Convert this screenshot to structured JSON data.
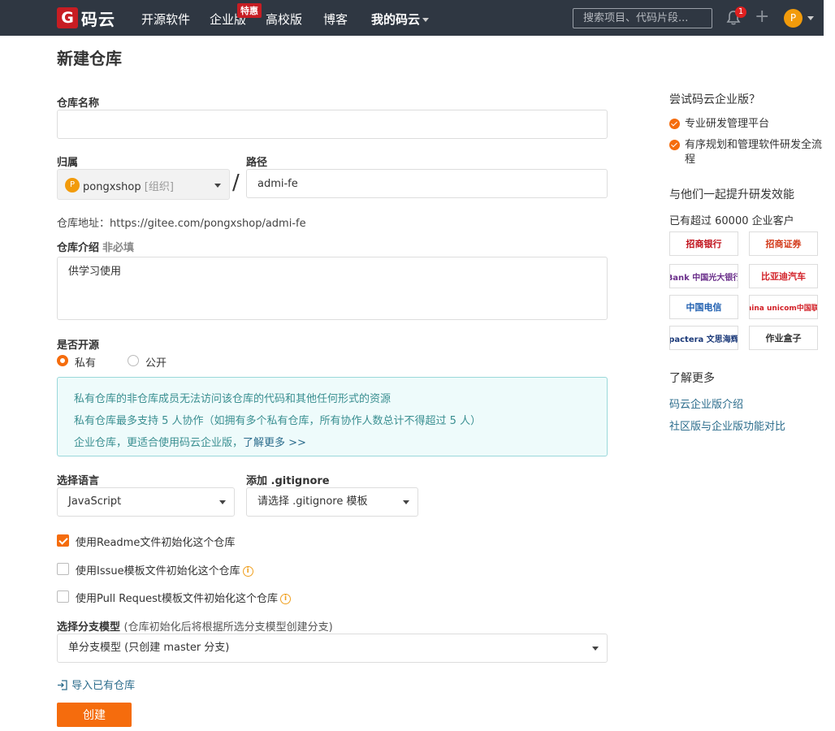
{
  "navbar": {
    "logo_mark": "G",
    "logo_text": "码云",
    "links": [
      "开源软件",
      "企业版",
      "高校版",
      "博客",
      "我的码云"
    ],
    "promo_badge": "特惠",
    "search_placeholder": "搜索项目、代码片段...",
    "notification_count": "1",
    "plus": "+",
    "avatar_letter": "P"
  },
  "page": {
    "title": "新建仓库"
  },
  "form": {
    "repo_name_label": "仓库名称",
    "repo_name_value": "",
    "owner_label": "归属",
    "owner_avatar": "P",
    "owner_name": "pongxshop",
    "owner_type": "[组织]",
    "path_label": "路径",
    "path_value": "admi-fe",
    "slash": "/",
    "repo_address": "仓库地址：https://gitee.com/pongxshop/admi-fe",
    "desc_label": "仓库介绍",
    "desc_optional": "非必填",
    "desc_value": "供学习使用",
    "visibility_label": "是否开源",
    "visibility_options": [
      "私有",
      "公开"
    ],
    "visibility_selected": "私有",
    "notice_lines": [
      "私有仓库的非仓库成员无法访问该仓库的代码和其他任何形式的资源",
      "私有仓库最多支持 5 人协作（如拥有多个私有仓库，所有协作人数总计不得超过 5 人）",
      "企业仓库，更适合使用码云企业版，"
    ],
    "notice_link": "了解更多 >>",
    "language_label": "选择语言",
    "language_value": "JavaScript",
    "gitignore_label": "添加 .gitignore",
    "gitignore_value": "请选择 .gitignore 模板",
    "checkboxes": [
      {
        "label": "使用Readme文件初始化这个仓库",
        "checked": true
      },
      {
        "label": "使用Issue模板文件初始化这个仓库",
        "checked": false
      },
      {
        "label": "使用Pull Request模板文件初始化这个仓库",
        "checked": false
      }
    ],
    "info_glyph": "i",
    "branch_label": "选择分支模型",
    "branch_hint": "(仓库初始化后将根据所选分支模型创建分支)",
    "branch_value": "单分支模型 (只创建 master 分支)",
    "import_link": "导入已有仓库",
    "submit_label": "创建"
  },
  "sidebar": {
    "try_title": "尝试码云企业版？",
    "features": [
      "专业研发管理平台",
      "有序规划和管理软件研发全流程"
    ],
    "together_title": "与他们一起提升研发效能",
    "customers_text": "已有超过 60000 企业客户",
    "customer_logos": [
      {
        "name": "招商银行",
        "color": "#c0101a"
      },
      {
        "name": "招商证券",
        "color": "#d33a1a"
      },
      {
        "name": "Bank 中国光大银行",
        "color": "#6a2e8a"
      },
      {
        "name": "比亚迪汽车",
        "color": "#d21f26"
      },
      {
        "name": "中国电信",
        "color": "#1f5fb0"
      },
      {
        "name": "China unicom中国联通",
        "color": "#d21f26"
      },
      {
        "name": "pactera 文思海辉",
        "color": "#1d3b7a"
      },
      {
        "name": "作业盒子",
        "color": "#333333"
      }
    ],
    "learn_more_title": "了解更多",
    "links": [
      "码云企业版介绍",
      "社区版与企业版功能对比"
    ]
  },
  "colors": {
    "navbar_bg": "#2f3742",
    "accent": "#f56c0d",
    "brand_red": "#c71d23",
    "link": "#2b6c8c"
  }
}
